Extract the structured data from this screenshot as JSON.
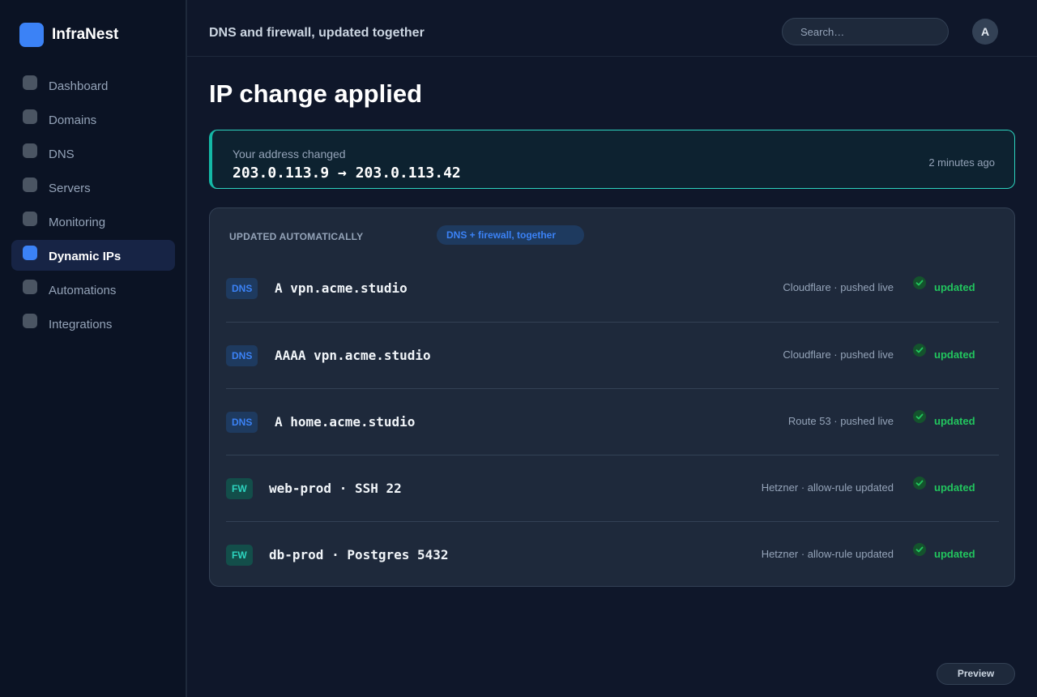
{
  "app": {
    "name": "InfraNest"
  },
  "sidebar": {
    "items": [
      {
        "label": "Dashboard",
        "active": false
      },
      {
        "label": "Domains",
        "active": false
      },
      {
        "label": "DNS",
        "active": false
      },
      {
        "label": "Servers",
        "active": false
      },
      {
        "label": "Monitoring",
        "active": false
      },
      {
        "label": "Dynamic IPs",
        "active": true
      },
      {
        "label": "Automations",
        "active": false
      },
      {
        "label": "Integrations",
        "active": false
      }
    ]
  },
  "header": {
    "title": "DNS and firewall, updated together",
    "search_placeholder": "Search…",
    "avatar_initial": "A"
  },
  "main": {
    "title": "IP change applied",
    "banner": {
      "label": "Your address changed",
      "value": "203.0.113.9 → 203.0.113.42",
      "time": "2 minutes ago"
    },
    "card": {
      "title": "UPDATED AUTOMATICALLY",
      "chip": "DNS + firewall, together",
      "rows": [
        {
          "type": "DNS",
          "target": "A vpn.acme.studio",
          "provider": "Cloudflare · pushed live",
          "status": "updated"
        },
        {
          "type": "DNS",
          "target": "AAAA vpn.acme.studio",
          "provider": "Cloudflare · pushed live",
          "status": "updated"
        },
        {
          "type": "DNS",
          "target": "A home.acme.studio",
          "provider": "Route 53 · pushed live",
          "status": "updated"
        },
        {
          "type": "FW",
          "target": "web-prod · SSH 22",
          "provider": "Hetzner · allow-rule updated",
          "status": "updated"
        },
        {
          "type": "FW",
          "target": "db-prod · Postgres 5432",
          "provider": "Hetzner · allow-rule updated",
          "status": "updated"
        }
      ]
    }
  },
  "footer": {
    "preview_label": "Preview"
  },
  "colors": {
    "accent": "#3b82f6",
    "success": "#22c55e",
    "teal": "#14b8a6"
  }
}
